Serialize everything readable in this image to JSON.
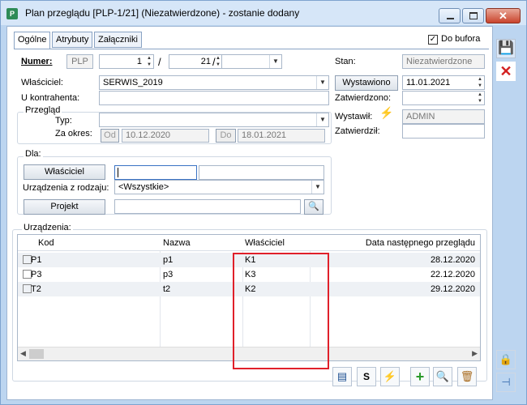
{
  "window": {
    "title": "Plan przeglądu [PLP-1/21] (Niezatwierdzone) - zostanie dodany",
    "app_icon": "P"
  },
  "tabs": [
    "Ogólne",
    "Atrybuty",
    "Załączniki"
  ],
  "do_bufora": {
    "label": "Do bufora",
    "checked": true
  },
  "numer": {
    "label": "Numer:",
    "prefix": "PLP",
    "num": "1",
    "month": "21",
    "series": ""
  },
  "wlasciciel": {
    "label": "Właściciel:",
    "value": "SERWIS_2019"
  },
  "u_kontrahenta": {
    "label": "U kontrahenta:",
    "value": ""
  },
  "przeglad": {
    "group": "Przegląd",
    "typ_label": "Typ:",
    "typ_value": "",
    "za_okres_label": "Za okres:",
    "od_label": "Od",
    "od_value": "10.12.2020",
    "do_label": "Do",
    "do_value": "18.01.2021"
  },
  "status": {
    "stan_label": "Stan:",
    "stan_value": "Niezatwierdzone",
    "wystawiono_btn": "Wystawiono",
    "wystawiono_value": "11.01.2021",
    "zatwierdzono_label": "Zatwierdzono:",
    "zatwierdzono_value": "",
    "wystawil_label": "Wystawił:",
    "wystawil_value": "ADMIN",
    "zatwierdzil_label": "Zatwierdził:",
    "zatwierdzil_value": ""
  },
  "dla": {
    "group": "Dla:",
    "wlasciciel_btn": "Właściciel",
    "wlasciciel_code": "",
    "wlasciciel_name": "",
    "urzadzenia_label": "Urządzenia z rodzaju:",
    "urzadzenia_value": "<Wszystkie>",
    "projekt_btn": "Projekt",
    "projekt_value": ""
  },
  "urzadzenia": {
    "group": "Urządzenia:",
    "columns": [
      "Kod",
      "Nazwa",
      "Właściciel",
      "Data następnego przeglądu"
    ],
    "rows": [
      {
        "kod": "P1",
        "nazwa": "p1",
        "wlasciciel": "K1",
        "data": "28.12.2020"
      },
      {
        "kod": "P3",
        "nazwa": "p3",
        "wlasciciel": "K3",
        "data": "22.12.2020"
      },
      {
        "kod": "T2",
        "nazwa": "t2",
        "wlasciciel": "K2",
        "data": "29.12.2020"
      }
    ]
  },
  "colors": {
    "accent": "#2e6db4",
    "highlight": "#e0202a",
    "frame": "#bcd5f0"
  }
}
